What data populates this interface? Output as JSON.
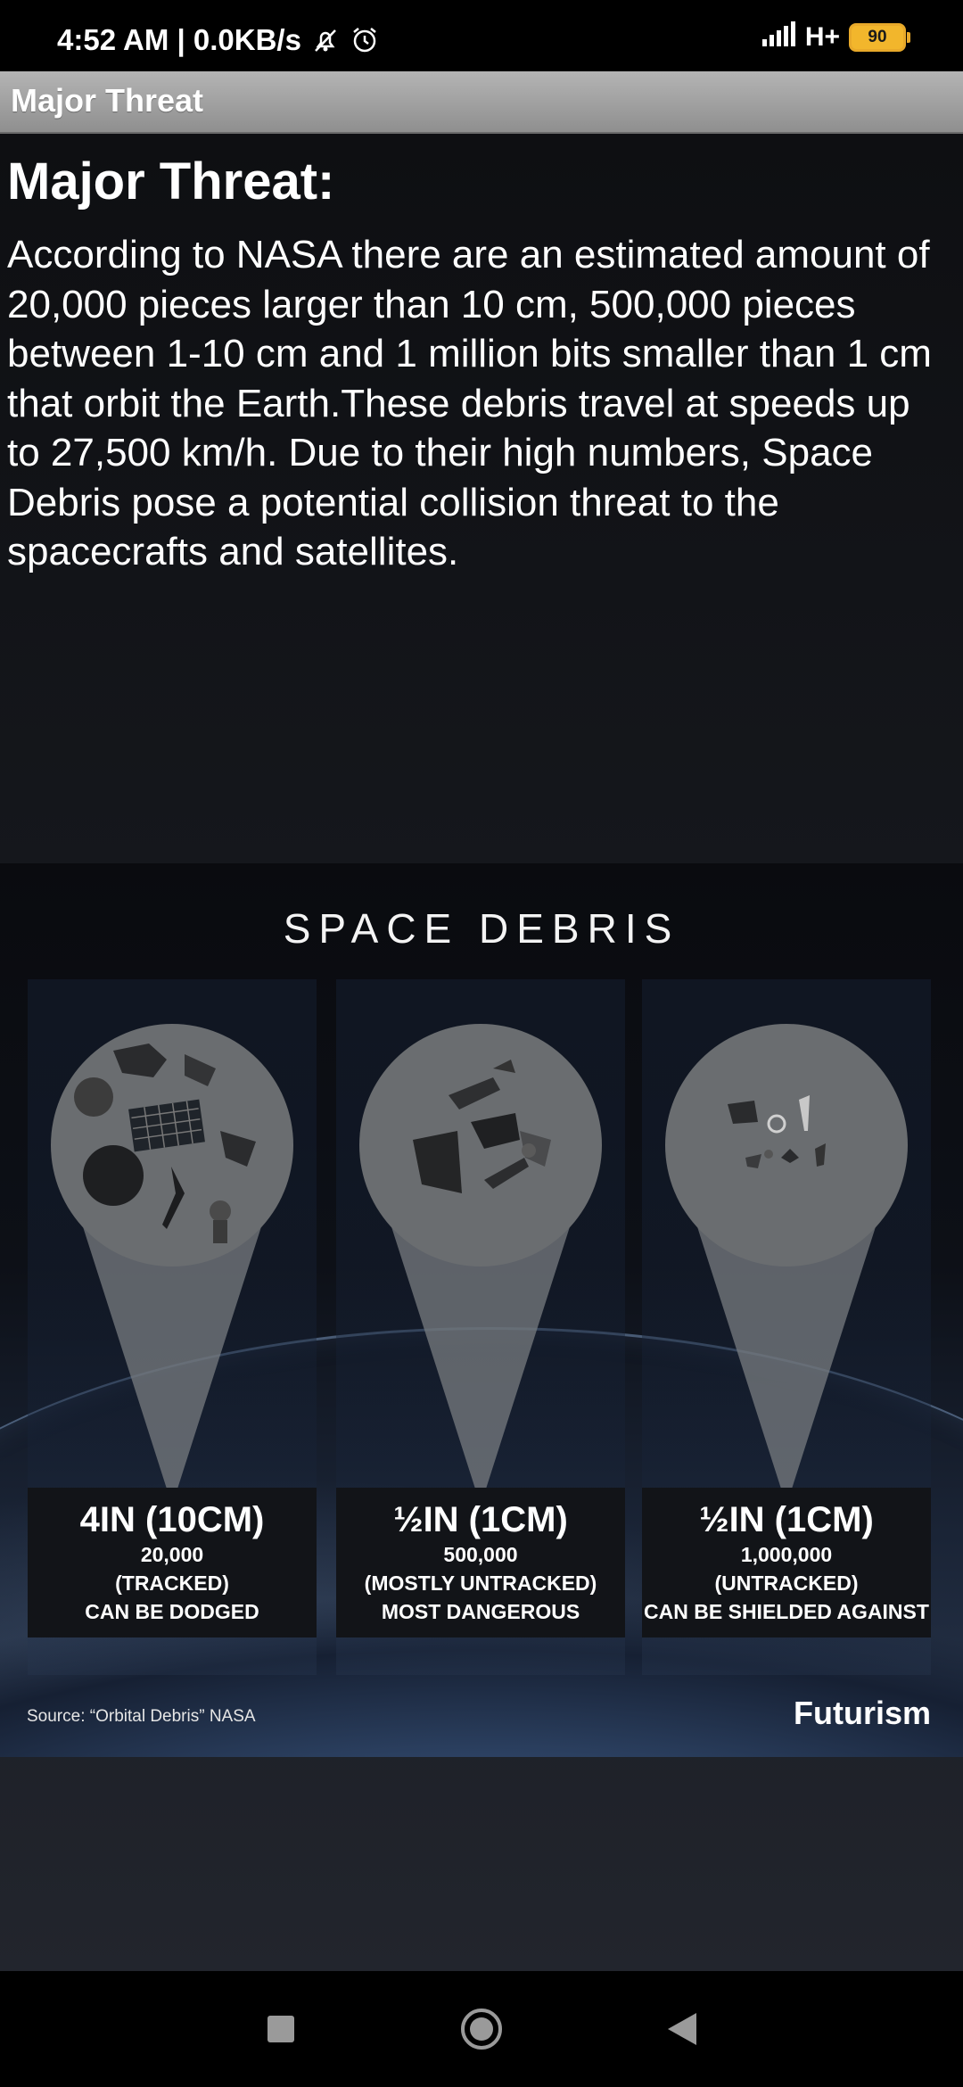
{
  "status_bar": {
    "time_speed": "4:52 AM | 0.0KB/s",
    "network": "H+",
    "battery": "90"
  },
  "app_bar": {
    "title": "Major Threat"
  },
  "article": {
    "heading": "Major Threat:",
    "body": "According to NASA there are an estimated amount of 20,000 pieces larger than 10 cm, 500,000 pieces between 1-10 cm and 1 million bits smaller than 1 cm that orbit the Earth.These debris travel at speeds up to  27,500 km/h. Due to their high numbers, Space Debris pose a potential collision threat to the spacecrafts and satellites."
  },
  "infographic": {
    "title": "SPACE DEBRIS",
    "panels": [
      {
        "size": "4IN (10CM)",
        "count": "20,000",
        "status": "(TRACKED)",
        "note": "CAN BE DODGED"
      },
      {
        "size": "½IN (1CM)",
        "count": "500,000",
        "status": "(MOSTLY UNTRACKED)",
        "note": "MOST DANGEROUS"
      },
      {
        "size": "½IN (1CM)",
        "count": "1,000,000",
        "status": "(UNTRACKED)",
        "note": "CAN BE SHIELDED AGAINST"
      }
    ],
    "source": "Source: “Orbital Debris” NASA",
    "brand": "Futurism"
  },
  "nav_bar": {
    "icons": [
      "recent-apps-icon",
      "home-icon",
      "back-icon"
    ]
  }
}
